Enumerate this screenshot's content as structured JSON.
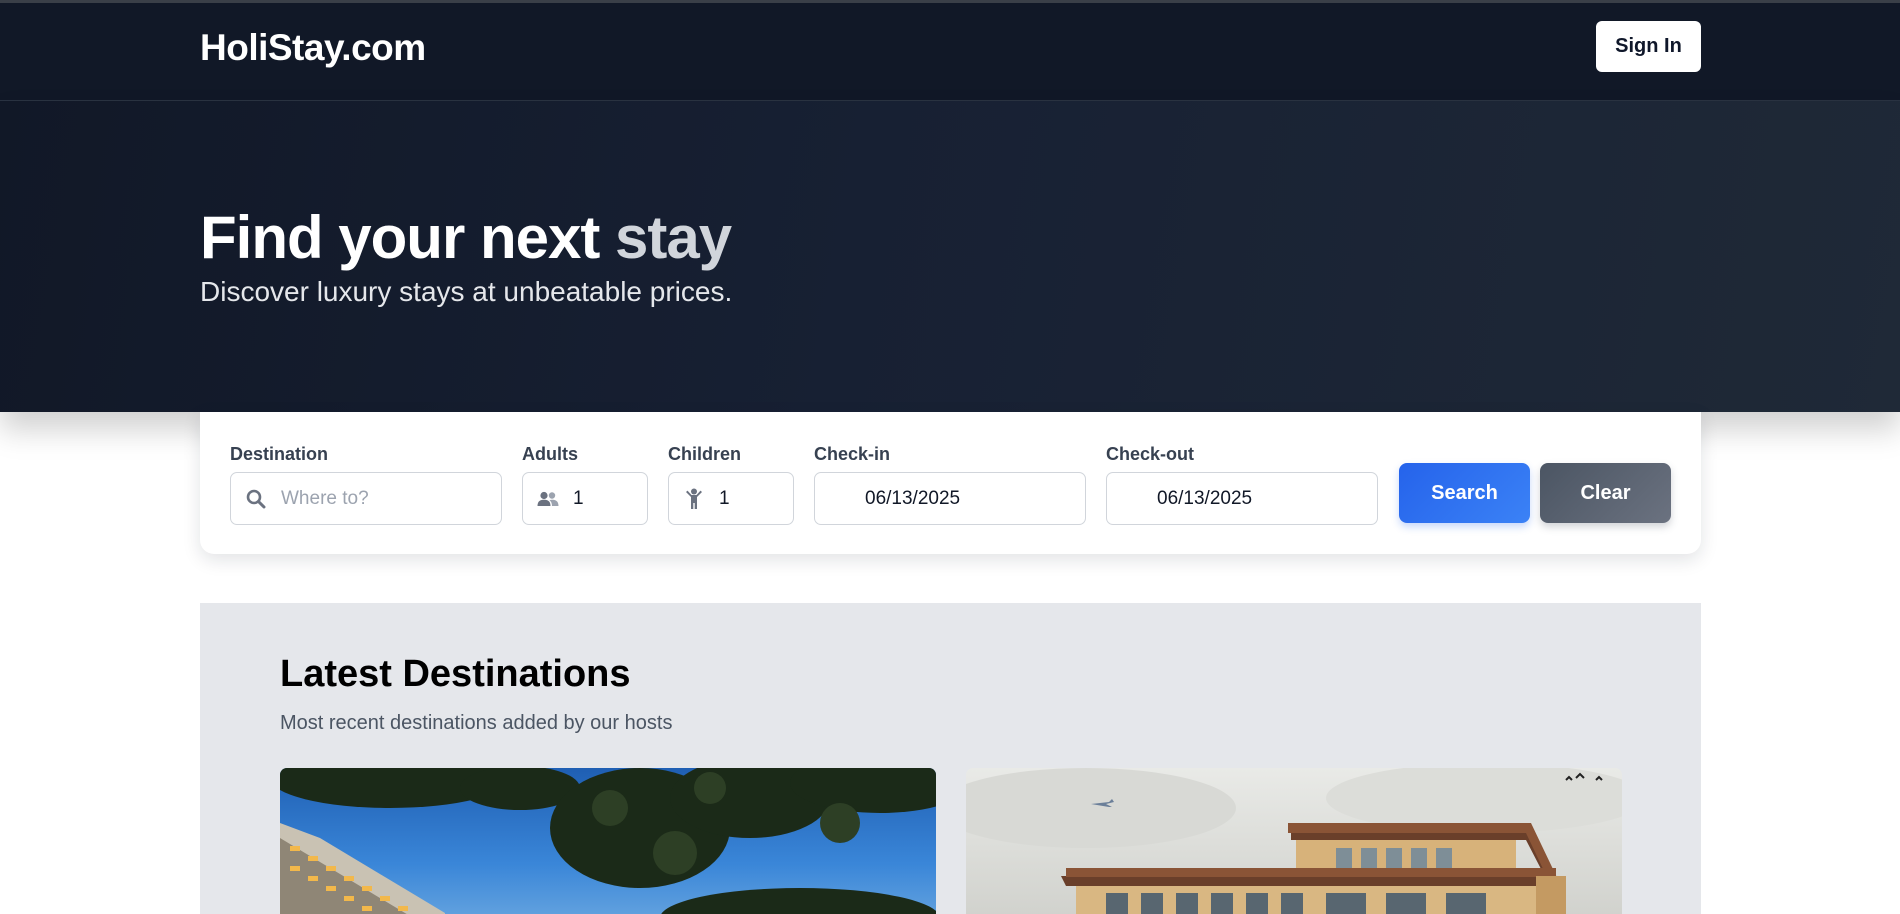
{
  "header": {
    "logo": "HoliStay.com",
    "sign_in_label": "Sign In"
  },
  "hero": {
    "title_main": "Find your next ",
    "title_accent": "stay",
    "subtitle": "Discover luxury stays at unbeatable prices."
  },
  "search": {
    "destination": {
      "label": "Destination",
      "placeholder": "Where to?",
      "value": "",
      "icon": "search-icon"
    },
    "adults": {
      "label": "Adults",
      "value": "1",
      "icon": "users-icon"
    },
    "children": {
      "label": "Children",
      "value": "1",
      "icon": "child-icon"
    },
    "check_in": {
      "label": "Check-in",
      "value": "06/13/2025"
    },
    "check_out": {
      "label": "Check-out",
      "value": "06/13/2025"
    },
    "search_label": "Search",
    "clear_label": "Clear"
  },
  "latest": {
    "title": "Latest Destinations",
    "subtitle": "Most recent destinations added by our hosts"
  },
  "colors": {
    "header_bg": "#111827",
    "primary": "#2563eb",
    "secondary": "#4b5563",
    "section_bg": "#e5e7eb"
  }
}
